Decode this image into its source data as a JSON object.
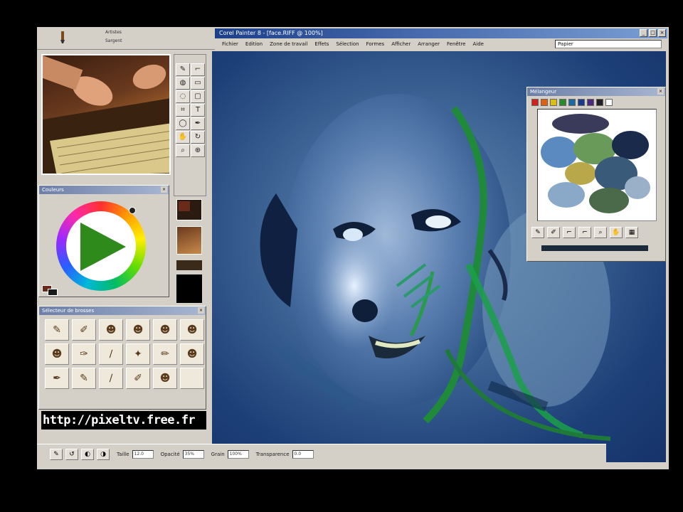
{
  "caption": "",
  "app": {
    "title": "Corel Painter 8 - [face.RIFF @ 100%]",
    "menus": [
      "Fichier",
      "Edition",
      "Zone de travail",
      "Effets",
      "Sélection",
      "Formes",
      "Afficher",
      "Arranger",
      "Fenêtre",
      "Aide"
    ],
    "layer_field": "Papier"
  },
  "propbar": {
    "category": "Artistes",
    "variant": "Sargent"
  },
  "panels": {
    "colors_title": "Couleurs",
    "brushes_title": "Sélecteur de brosses",
    "mixer_title": "Mélangeur"
  },
  "url_text": "http://pixeltv.free.fr",
  "bottombar": {
    "size_label": "Taille",
    "size_value": "12.0",
    "opacity_label": "Opacité",
    "opacity_value": "35%",
    "grain_label": "Grain",
    "grain_value": "100%",
    "blend_label": "Transparence",
    "blend_value": "0.0"
  },
  "icons": {
    "window_minimize": "minimize-icon",
    "window_maximize": "maximize-icon",
    "window_close": "close-icon"
  },
  "colors": {
    "titlebar": "#1c3f8a",
    "canvas_bg": "#1d3f78",
    "mixer_palette": [
      "#d02020",
      "#e06010",
      "#d8c010",
      "#2a8a2a",
      "#1a6a9a",
      "#1a3a8a",
      "#4a2a7a",
      "#202020",
      "#ffffff"
    ]
  }
}
